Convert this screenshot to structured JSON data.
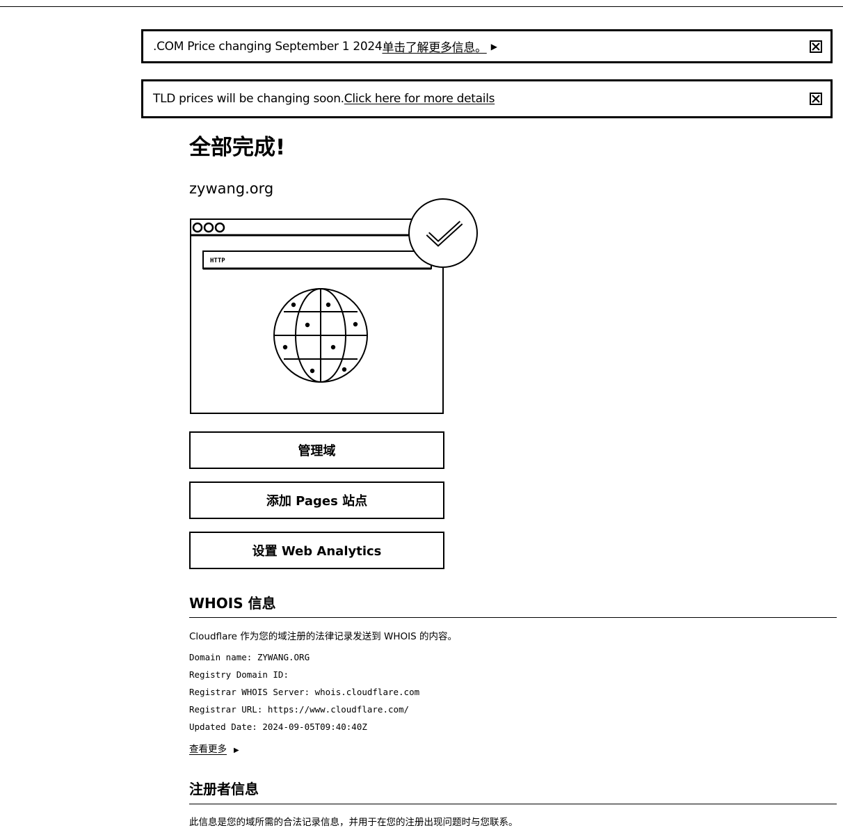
{
  "banners": [
    {
      "text": ".COM Price changing September 1 2024 ",
      "link": "单击了解更多信息。",
      "chevron": "▶",
      "close_icon": "close-icon"
    },
    {
      "text": "TLD prices will be changing soon. ",
      "link": "Click here for more details",
      "chevron": "",
      "close_icon": "close-icon"
    }
  ],
  "main": {
    "title": "全部完成!",
    "domain": "zywang.org",
    "illustration": {
      "address_bar_text": "HTTP"
    },
    "buttons": {
      "manage": "管理域",
      "pages": "添加 Pages 站点",
      "analytics": "设置 Web Analytics"
    }
  },
  "whois": {
    "title": "WHOIS 信息",
    "description": "Cloudflare 作为您的域注册的法律记录发送到 WHOIS 的内容。",
    "lines": [
      "Domain name: ZYWANG.ORG",
      "Registry Domain ID:",
      "Registrar WHOIS Server: whois.cloudflare.com",
      "Registrar URL: https://www.cloudflare.com/",
      "Updated Date: 2024-09-05T09:40:40Z"
    ],
    "view_more": "查看更多",
    "view_more_arrow": "▶"
  },
  "registrant": {
    "title": "注册者信息",
    "description": "此信息是您的域所需的合法记录信息，并用于在您的注册出现问题时与您联系。"
  }
}
